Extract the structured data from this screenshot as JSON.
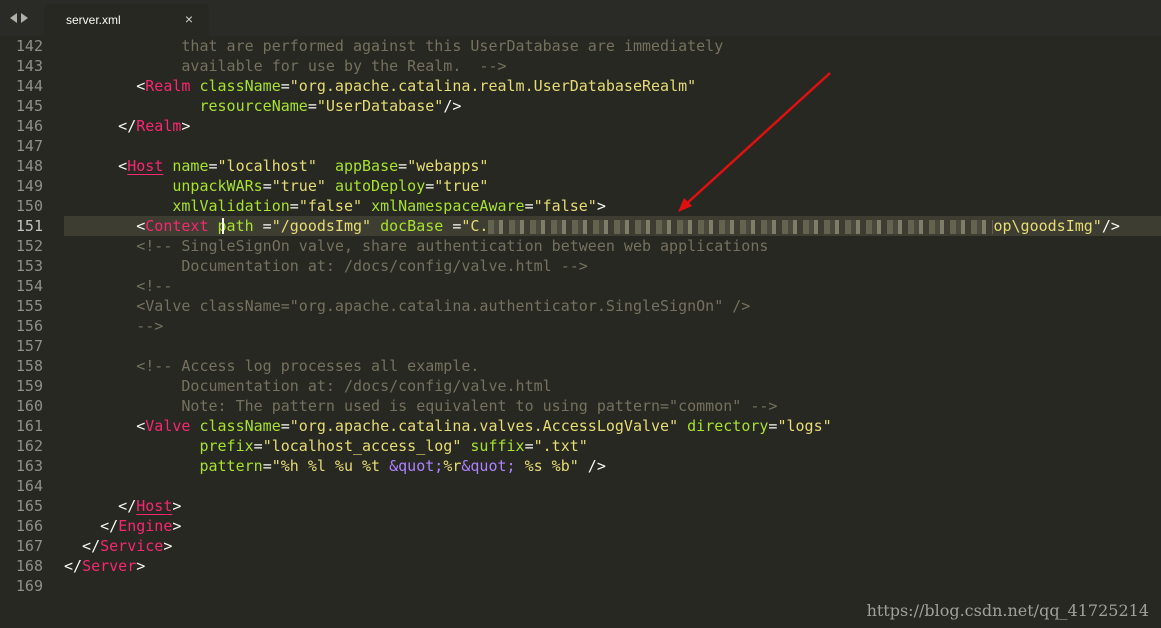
{
  "tab": {
    "label": "server.xml",
    "close_glyph": "×"
  },
  "nav": {
    "back_icon": "triangle-left-icon",
    "forward_icon": "triangle-right-icon"
  },
  "editor": {
    "current_line": 151,
    "lines": [
      {
        "n": "142",
        "segs": [
          {
            "c": "t-com",
            "t": "             that are performed against this UserDatabase are immediately"
          }
        ]
      },
      {
        "n": "143",
        "segs": [
          {
            "c": "t-com",
            "t": "             available for use by the Realm.  -->"
          }
        ]
      },
      {
        "n": "144",
        "segs": [
          {
            "c": "t-pun",
            "t": "        <"
          },
          {
            "c": "t-tag-nu",
            "t": "Realm"
          },
          {
            "c": "t-pun",
            "t": " "
          },
          {
            "c": "t-attr",
            "t": "className"
          },
          {
            "c": "t-pun",
            "t": "="
          },
          {
            "c": "t-str",
            "t": "\"org.apache.catalina.realm.UserDatabaseRealm\""
          }
        ]
      },
      {
        "n": "145",
        "segs": [
          {
            "c": "t-pun",
            "t": "               "
          },
          {
            "c": "t-attr",
            "t": "resourceName"
          },
          {
            "c": "t-pun",
            "t": "="
          },
          {
            "c": "t-str",
            "t": "\"UserDatabase\""
          },
          {
            "c": "t-pun",
            "t": "/>"
          }
        ]
      },
      {
        "n": "146",
        "segs": [
          {
            "c": "t-pun",
            "t": "      </"
          },
          {
            "c": "t-tag-nu",
            "t": "Realm"
          },
          {
            "c": "t-pun",
            "t": ">"
          }
        ]
      },
      {
        "n": "147",
        "segs": [
          {
            "c": "t-pun",
            "t": ""
          }
        ]
      },
      {
        "n": "148",
        "segs": [
          {
            "c": "t-pun",
            "t": "      <"
          },
          {
            "c": "t-tag",
            "t": "Host"
          },
          {
            "c": "t-pun",
            "t": " "
          },
          {
            "c": "t-attr",
            "t": "name"
          },
          {
            "c": "t-pun",
            "t": "="
          },
          {
            "c": "t-str",
            "t": "\"localhost\""
          },
          {
            "c": "t-pun",
            "t": "  "
          },
          {
            "c": "t-attr",
            "t": "appBase"
          },
          {
            "c": "t-pun",
            "t": "="
          },
          {
            "c": "t-str",
            "t": "\"webapps\""
          }
        ]
      },
      {
        "n": "149",
        "segs": [
          {
            "c": "t-pun",
            "t": "            "
          },
          {
            "c": "t-attr",
            "t": "unpackWARs"
          },
          {
            "c": "t-pun",
            "t": "="
          },
          {
            "c": "t-str",
            "t": "\"true\""
          },
          {
            "c": "t-pun",
            "t": " "
          },
          {
            "c": "t-attr",
            "t": "autoDeploy"
          },
          {
            "c": "t-pun",
            "t": "="
          },
          {
            "c": "t-str",
            "t": "\"true\""
          }
        ]
      },
      {
        "n": "150",
        "segs": [
          {
            "c": "t-pun",
            "t": "            "
          },
          {
            "c": "t-attr",
            "t": "xmlValidation"
          },
          {
            "c": "t-pun",
            "t": "="
          },
          {
            "c": "t-str",
            "t": "\"false\""
          },
          {
            "c": "t-pun",
            "t": " "
          },
          {
            "c": "t-attr",
            "t": "xmlNamespaceAware"
          },
          {
            "c": "t-pun",
            "t": "="
          },
          {
            "c": "t-str",
            "t": "\"false\""
          },
          {
            "c": "t-pun",
            "t": ">"
          }
        ]
      },
      {
        "n": "151",
        "current": true,
        "segs": [
          {
            "c": "t-pun",
            "t": "        <"
          },
          {
            "c": "t-tag-nu",
            "t": "Context"
          },
          {
            "c": "t-pun",
            "t": " "
          },
          {
            "c": "t-attr",
            "t": "path"
          },
          {
            "c": "t-pun",
            "t": " ="
          },
          {
            "c": "t-str",
            "t": "\"/goodsImg\""
          },
          {
            "c": "t-pun",
            "t": " "
          },
          {
            "c": "t-attr",
            "t": "docBase"
          },
          {
            "c": "t-pun",
            "t": " ="
          },
          {
            "c": "t-str",
            "t": "\"C."
          },
          {
            "c": "t-blur",
            "t": ""
          },
          {
            "c": "t-str",
            "t": "op\\goodsImg\""
          },
          {
            "c": "t-pun",
            "t": "/>"
          }
        ]
      },
      {
        "n": "152",
        "segs": [
          {
            "c": "t-com",
            "t": "        <!-- SingleSignOn valve, share authentication between web applications"
          }
        ]
      },
      {
        "n": "153",
        "segs": [
          {
            "c": "t-com",
            "t": "             Documentation at: /docs/config/valve.html -->"
          }
        ]
      },
      {
        "n": "154",
        "segs": [
          {
            "c": "t-com",
            "t": "        <!--"
          }
        ]
      },
      {
        "n": "155",
        "segs": [
          {
            "c": "t-com",
            "t": "        <Valve className=\"org.apache.catalina.authenticator.SingleSignOn\" />"
          }
        ]
      },
      {
        "n": "156",
        "segs": [
          {
            "c": "t-com",
            "t": "        -->"
          }
        ]
      },
      {
        "n": "157",
        "segs": [
          {
            "c": "t-pun",
            "t": ""
          }
        ]
      },
      {
        "n": "158",
        "segs": [
          {
            "c": "t-com",
            "t": "        <!-- Access log processes all example."
          }
        ]
      },
      {
        "n": "159",
        "segs": [
          {
            "c": "t-com",
            "t": "             Documentation at: /docs/config/valve.html"
          }
        ]
      },
      {
        "n": "160",
        "segs": [
          {
            "c": "t-com",
            "t": "             Note: The pattern used is equivalent to using pattern=\"common\" -->"
          }
        ]
      },
      {
        "n": "161",
        "segs": [
          {
            "c": "t-pun",
            "t": "        <"
          },
          {
            "c": "t-tag-nu",
            "t": "Valve"
          },
          {
            "c": "t-pun",
            "t": " "
          },
          {
            "c": "t-attr",
            "t": "className"
          },
          {
            "c": "t-pun",
            "t": "="
          },
          {
            "c": "t-str",
            "t": "\"org.apache.catalina.valves.AccessLogValve\""
          },
          {
            "c": "t-pun",
            "t": " "
          },
          {
            "c": "t-attr",
            "t": "directory"
          },
          {
            "c": "t-pun",
            "t": "="
          },
          {
            "c": "t-str",
            "t": "\"logs\""
          }
        ]
      },
      {
        "n": "162",
        "segs": [
          {
            "c": "t-pun",
            "t": "               "
          },
          {
            "c": "t-attr",
            "t": "prefix"
          },
          {
            "c": "t-pun",
            "t": "="
          },
          {
            "c": "t-str",
            "t": "\"localhost_access_log\""
          },
          {
            "c": "t-pun",
            "t": " "
          },
          {
            "c": "t-attr",
            "t": "suffix"
          },
          {
            "c": "t-pun",
            "t": "="
          },
          {
            "c": "t-str",
            "t": "\".txt\""
          }
        ]
      },
      {
        "n": "163",
        "segs": [
          {
            "c": "t-pun",
            "t": "               "
          },
          {
            "c": "t-attr",
            "t": "pattern"
          },
          {
            "c": "t-pun",
            "t": "="
          },
          {
            "c": "t-str",
            "t": "\"%h %l %u %t "
          },
          {
            "c": "t-ent",
            "t": "&quot;"
          },
          {
            "c": "t-str",
            "t": "%r"
          },
          {
            "c": "t-ent",
            "t": "&quot;"
          },
          {
            "c": "t-str",
            "t": " %s %b\""
          },
          {
            "c": "t-pun",
            "t": " />"
          }
        ]
      },
      {
        "n": "164",
        "segs": [
          {
            "c": "t-pun",
            "t": ""
          }
        ]
      },
      {
        "n": "165",
        "segs": [
          {
            "c": "t-pun",
            "t": "      </"
          },
          {
            "c": "t-tag",
            "t": "Host"
          },
          {
            "c": "t-pun",
            "t": ">"
          }
        ]
      },
      {
        "n": "166",
        "segs": [
          {
            "c": "t-pun",
            "t": "    </"
          },
          {
            "c": "t-tag-nu",
            "t": "Engine"
          },
          {
            "c": "t-pun",
            "t": ">"
          }
        ]
      },
      {
        "n": "167",
        "segs": [
          {
            "c": "t-pun",
            "t": "  </"
          },
          {
            "c": "t-tag-nu",
            "t": "Service"
          },
          {
            "c": "t-pun",
            "t": ">"
          }
        ]
      },
      {
        "n": "168",
        "segs": [
          {
            "c": "t-pun",
            "t": "</"
          },
          {
            "c": "t-tag-nu",
            "t": "Server"
          },
          {
            "c": "t-pun",
            "t": ">"
          }
        ]
      },
      {
        "n": "169",
        "segs": [
          {
            "c": "t-pun",
            "t": ""
          }
        ]
      }
    ]
  },
  "watermark": "https://blog.csdn.net/qq_41725214",
  "annotation": {
    "color": "#e01010"
  }
}
